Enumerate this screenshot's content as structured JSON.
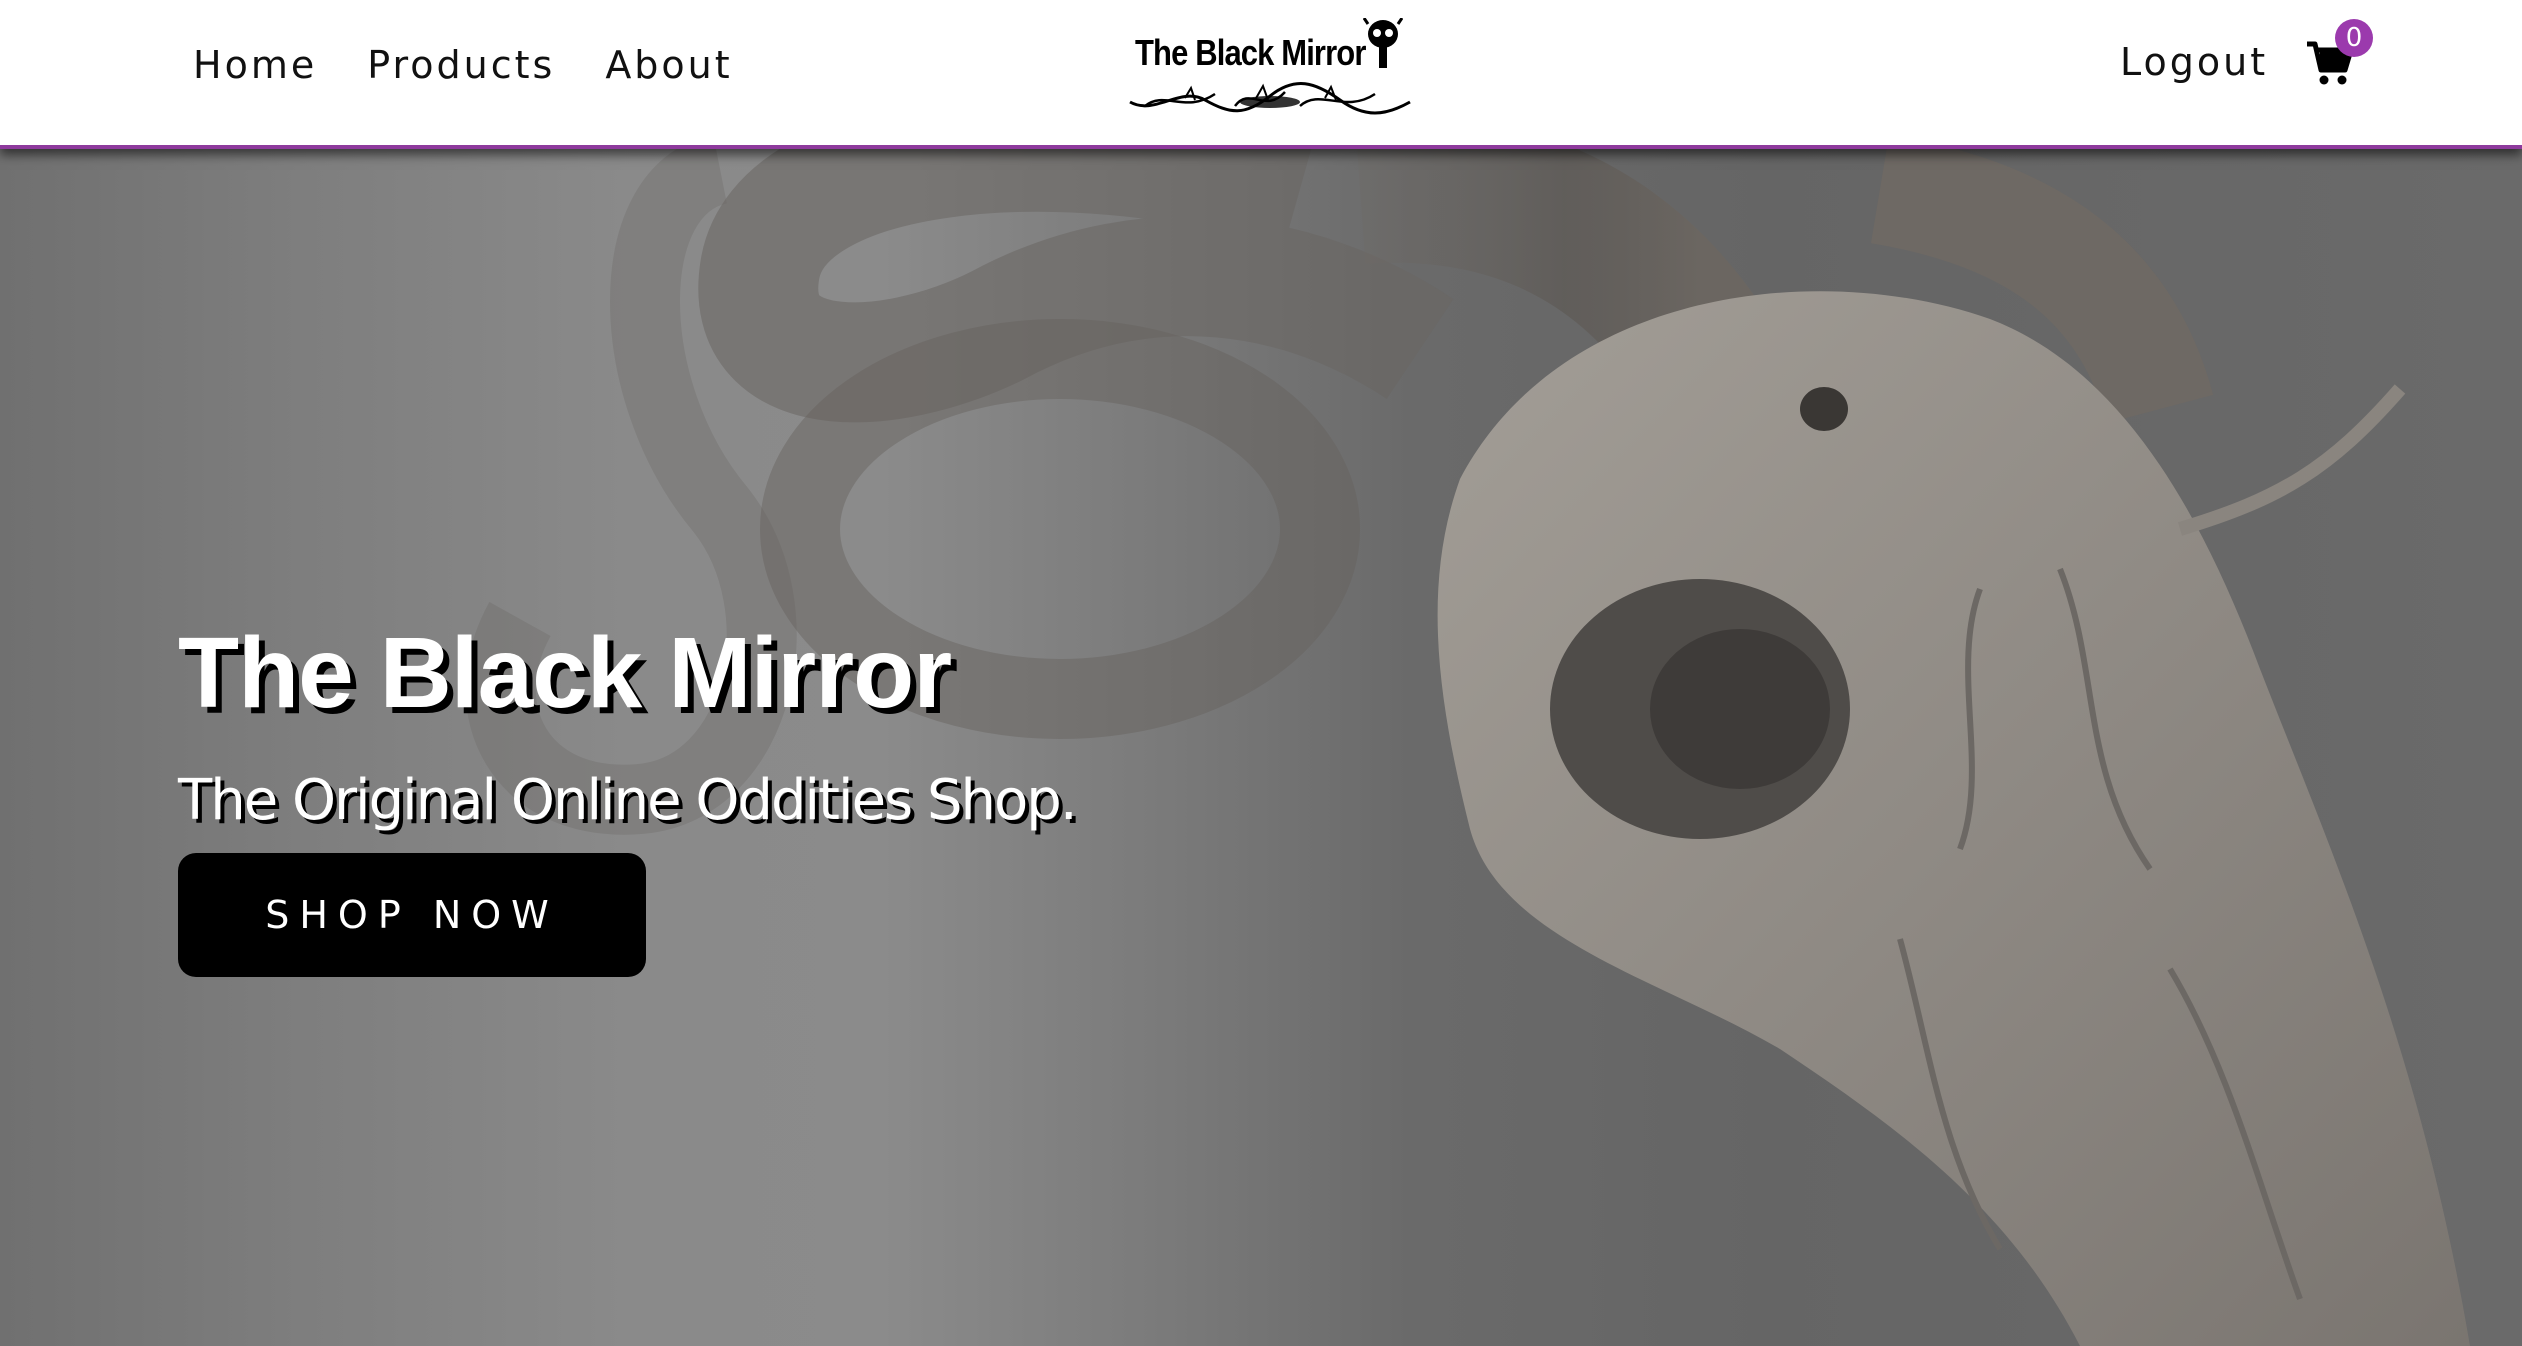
{
  "nav": {
    "links": [
      {
        "label": "Home"
      },
      {
        "label": "Products"
      },
      {
        "label": "About"
      }
    ],
    "logo_text": "The Black Mirror",
    "logout_label": "Logout",
    "cart_icon": "shopping-cart-icon",
    "cart_count": "0",
    "accent_color": "#8e3a9d"
  },
  "hero": {
    "title": "The Black Mirror",
    "subtitle": "The Original Online Oddities Shop.",
    "cta_label": "SHOP NOW",
    "background_image": "ram-skull-photo"
  }
}
